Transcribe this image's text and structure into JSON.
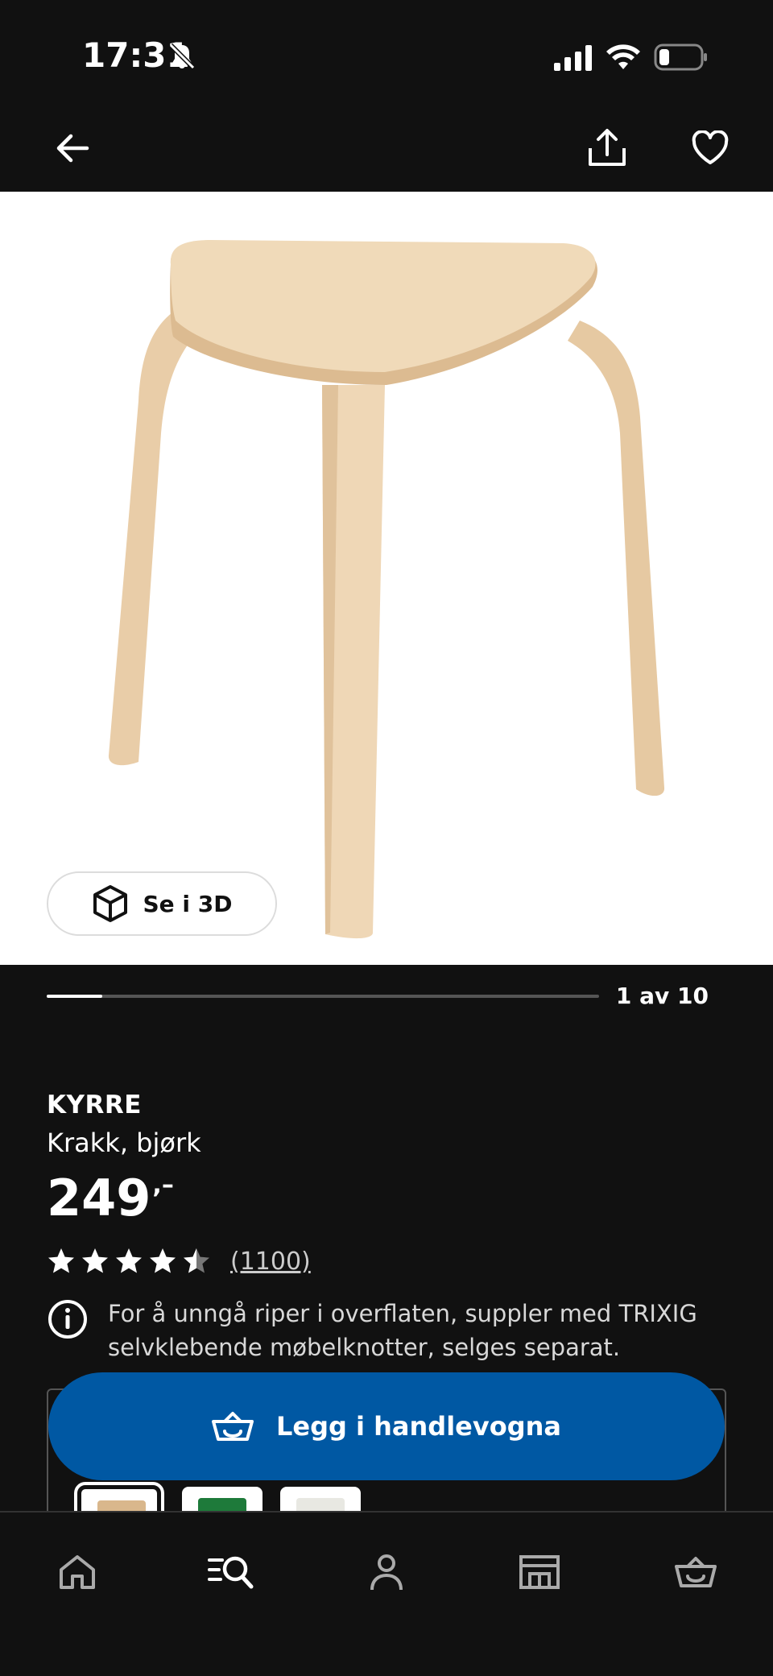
{
  "status_bar": {
    "time": "17:31"
  },
  "product": {
    "view_3d_label": "Se i 3D",
    "gallery_counter": "1 av 10",
    "gallery_progress": 0.1,
    "name": "KYRRE",
    "description": "Krakk, bjørk",
    "price": "249",
    "price_suffix": ",–",
    "rating": 4.5,
    "review_count": "(1100)",
    "info_text": "For å unngå riper i overflaten, suppler med TRIXIG selvklebende møbelknotter, selges separat."
  },
  "cart_button": {
    "label": "Legg i handlevogna"
  },
  "variants": [
    {
      "color": "#d9b78c",
      "selected": true
    },
    {
      "color": "#1e7a3a",
      "selected": false
    },
    {
      "color": "#e8e8e2",
      "selected": false
    }
  ],
  "colors": {
    "accent": "#0058a3",
    "background": "#111111"
  },
  "bottom_nav": {
    "items": [
      {
        "icon": "home-icon"
      },
      {
        "icon": "search-icon"
      },
      {
        "icon": "profile-icon"
      },
      {
        "icon": "store-icon"
      },
      {
        "icon": "cart-icon"
      }
    ]
  }
}
